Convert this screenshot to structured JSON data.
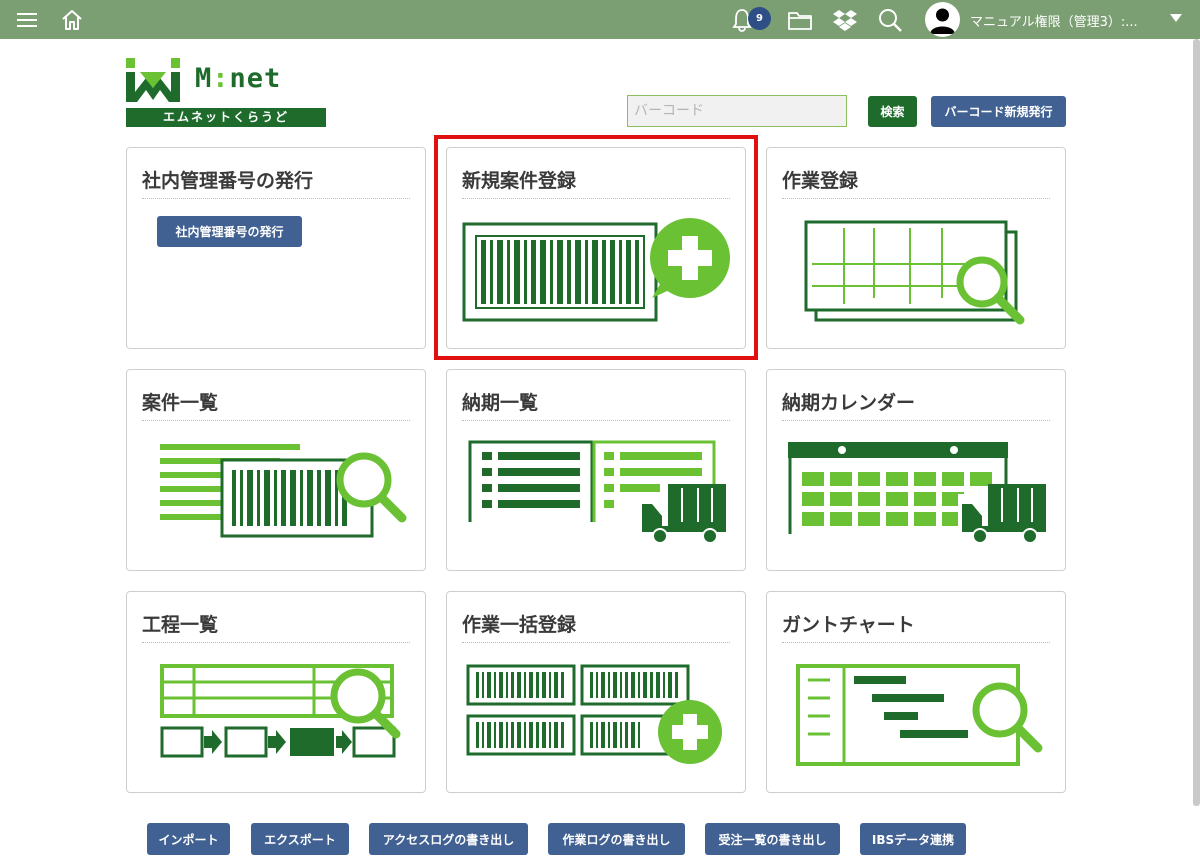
{
  "topbar": {
    "menu_icon": "hamburger-icon",
    "home_icon": "home-icon",
    "notification_count": "9",
    "user_name": "マニュアル権限（管理3）:..."
  },
  "logo": {
    "text_m": "M",
    "text_colon": ":",
    "text_net": "net",
    "band": "エムネットくらうど"
  },
  "search": {
    "placeholder": "バーコード",
    "search_label": "検索",
    "new_barcode_label": "バーコード新規発行"
  },
  "cards": {
    "c0": {
      "title": "社内管理番号の発行",
      "button": "社内管理番号の発行"
    },
    "c1": {
      "title": "新規案件登録"
    },
    "c2": {
      "title": "作業登録"
    },
    "c3": {
      "title": "案件一覧"
    },
    "c4": {
      "title": "納期一覧"
    },
    "c5": {
      "title": "納期カレンダー"
    },
    "c6": {
      "title": "工程一覧"
    },
    "c7": {
      "title": "作業一括登録"
    },
    "c8": {
      "title": "ガントチャート"
    }
  },
  "bottom": {
    "import": "インポート",
    "export": "エクスポート",
    "access_log": "アクセスログの書き出し",
    "work_log": "作業ログの書き出し",
    "orders": "受注一覧の書き出し",
    "ibs": "IBSデータ連携"
  },
  "colors": {
    "topbar": "#7b9e73",
    "dark_green": "#1e6b2c",
    "light_green": "#6ac134",
    "blue_button": "#406192",
    "highlight": "#e01010"
  }
}
